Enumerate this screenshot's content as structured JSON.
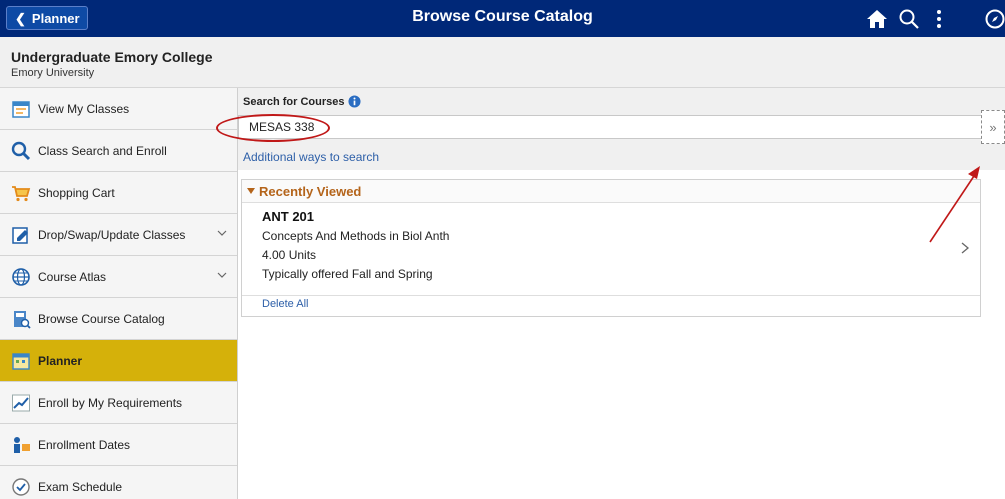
{
  "header": {
    "back_label": "Planner",
    "title": "Browse Course Catalog"
  },
  "subheader": {
    "career": "Undergraduate Emory College",
    "institution": "Emory University"
  },
  "sidebar": {
    "items": [
      {
        "label": "View My Classes"
      },
      {
        "label": "Class Search and Enroll"
      },
      {
        "label": "Shopping Cart"
      },
      {
        "label": "Drop/Swap/Update Classes"
      },
      {
        "label": "Course Atlas"
      },
      {
        "label": "Browse Course Catalog"
      },
      {
        "label": "Planner"
      },
      {
        "label": "Enroll by My Requirements"
      },
      {
        "label": "Enrollment Dates"
      },
      {
        "label": "Exam Schedule"
      }
    ],
    "active_color": "#d5b10a"
  },
  "search": {
    "label": "Search for Courses",
    "value": "MESAS 338",
    "additional_link": "Additional ways to search",
    "go_glyph": "»"
  },
  "recent": {
    "heading": "Recently Viewed",
    "course": {
      "code": "ANT 201",
      "title": "Concepts And Methods in Biol Anth",
      "units": "4.00 Units",
      "offered": "Typically offered Fall and Spring"
    },
    "delete_all": "Delete All"
  },
  "colors": {
    "header_bg": "#002878",
    "link": "#2d5fa8",
    "recent_heading": "#b4641a",
    "annotation": "#c01818"
  }
}
